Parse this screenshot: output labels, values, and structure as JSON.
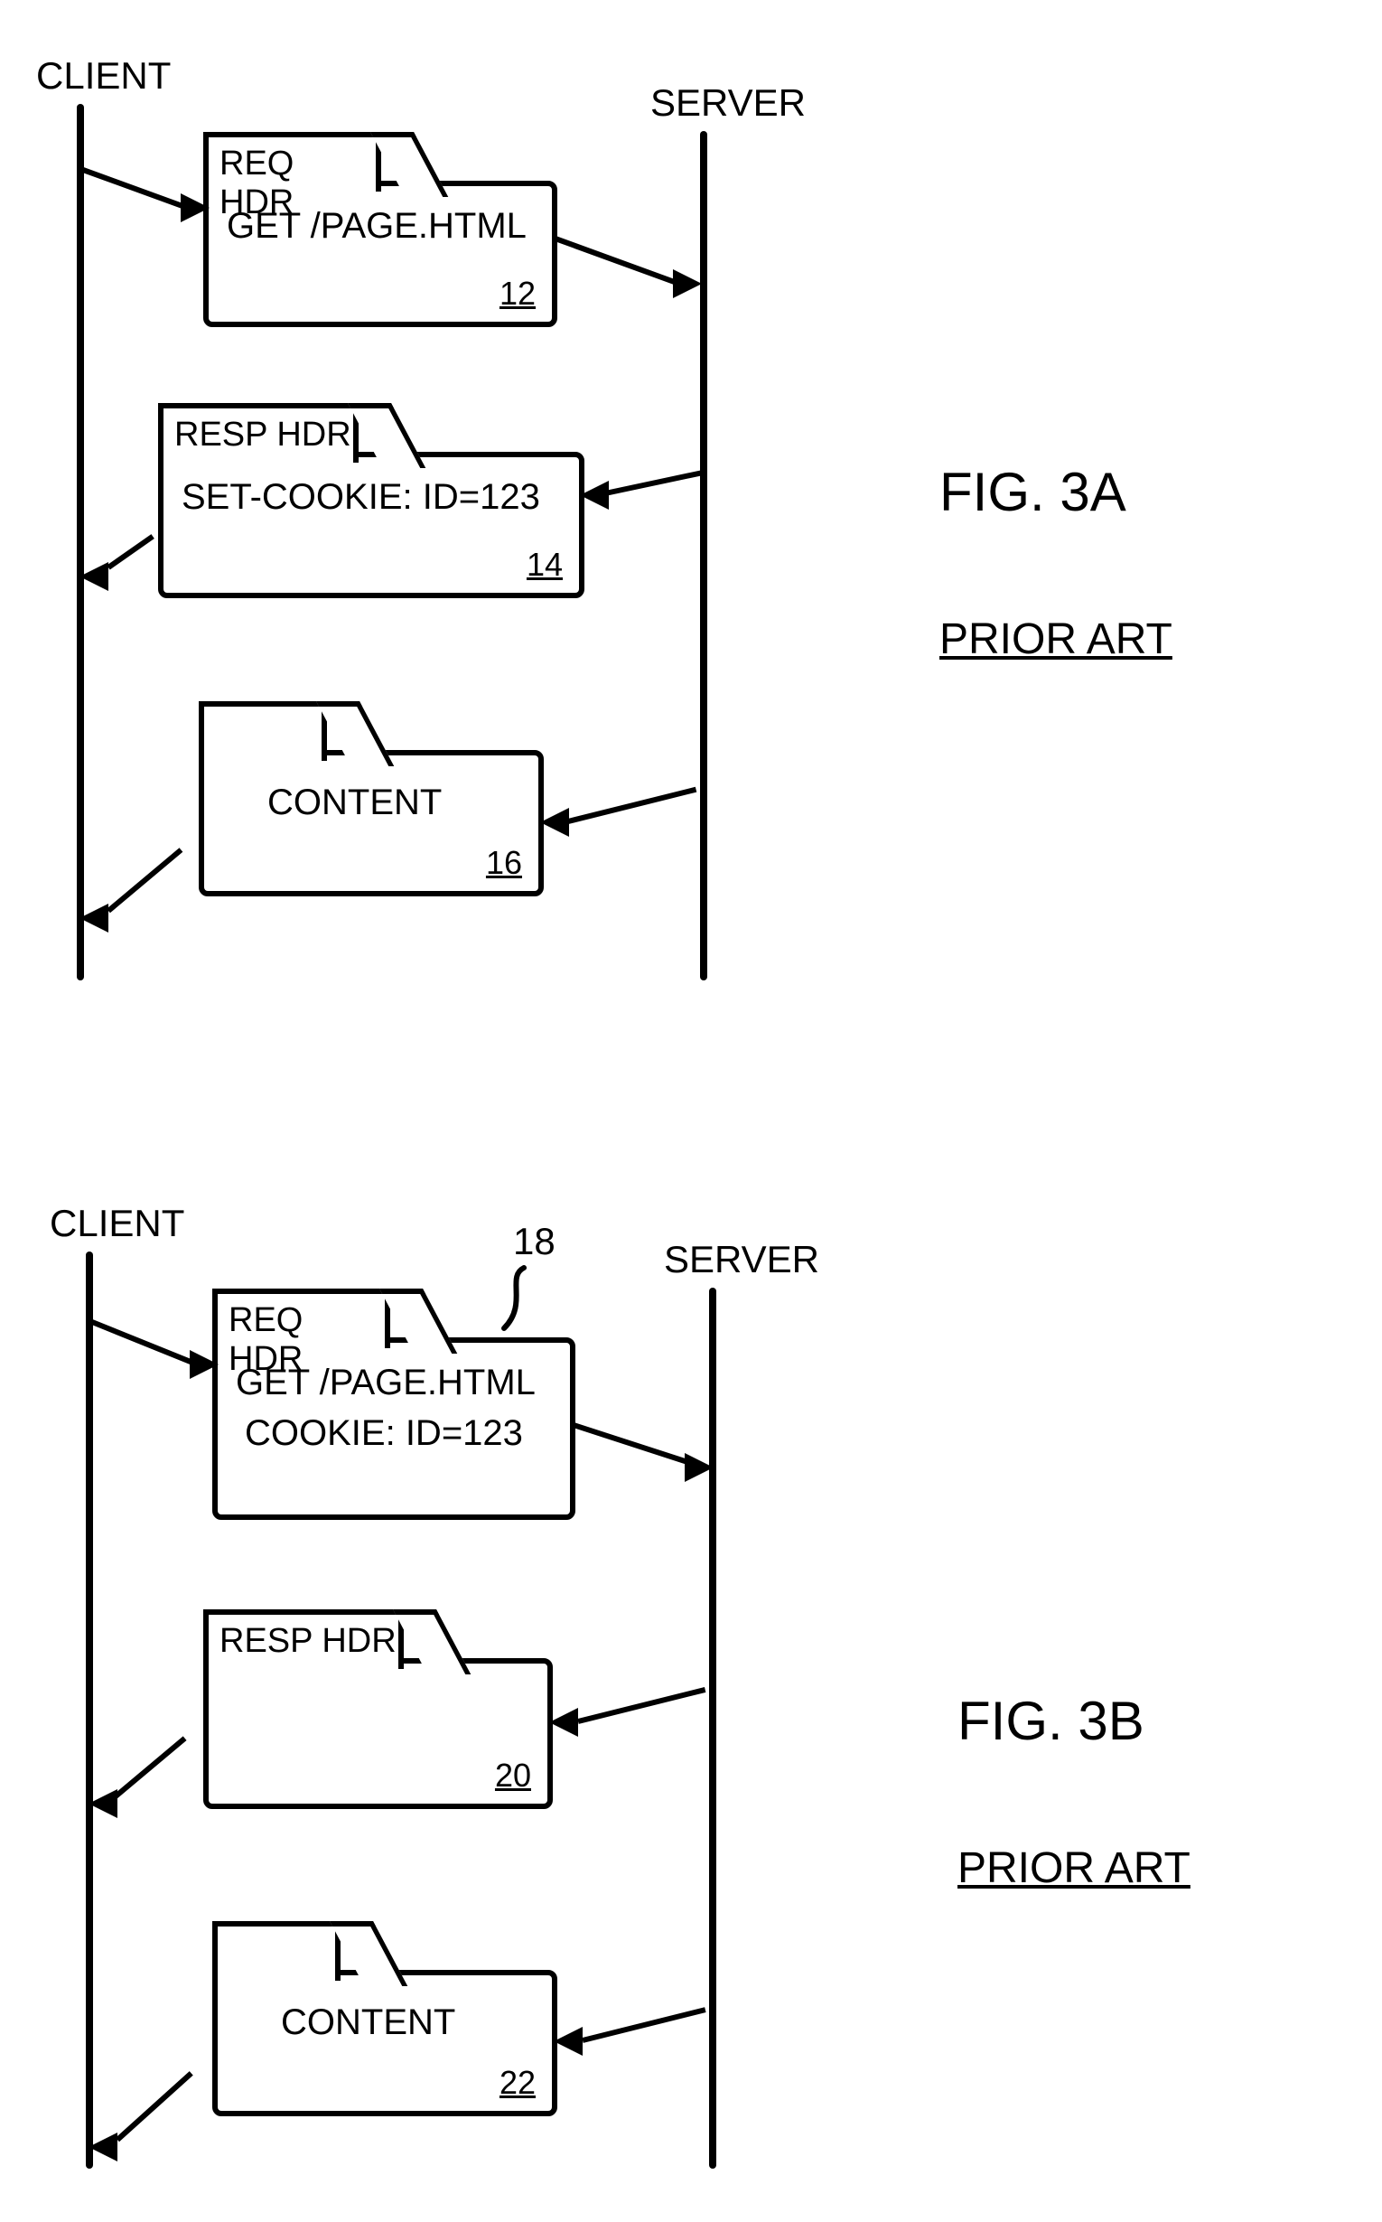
{
  "figA": {
    "client": "CLIENT",
    "server": "SERVER",
    "title": "FIG. 3A",
    "priorArt": "PRIOR ART",
    "req": {
      "tab": "REQ HDR",
      "line1": "GET /PAGE.HTML",
      "ref": "12"
    },
    "resp": {
      "tab": "RESP HDR",
      "line1": "SET-COOKIE: ID=123",
      "ref": "14"
    },
    "content": {
      "line1": "CONTENT",
      "ref": "16"
    }
  },
  "figB": {
    "client": "CLIENT",
    "server": "SERVER",
    "title": "FIG. 3B",
    "priorArt": "PRIOR ART",
    "callout": "18",
    "req": {
      "tab": "REQ HDR",
      "line1": "GET /PAGE.HTML",
      "line2": "COOKIE: ID=123",
      "ref": ""
    },
    "resp": {
      "tab": "RESP HDR",
      "line1": "",
      "ref": "20"
    },
    "content": {
      "line1": "CONTENT",
      "ref": "22"
    }
  }
}
